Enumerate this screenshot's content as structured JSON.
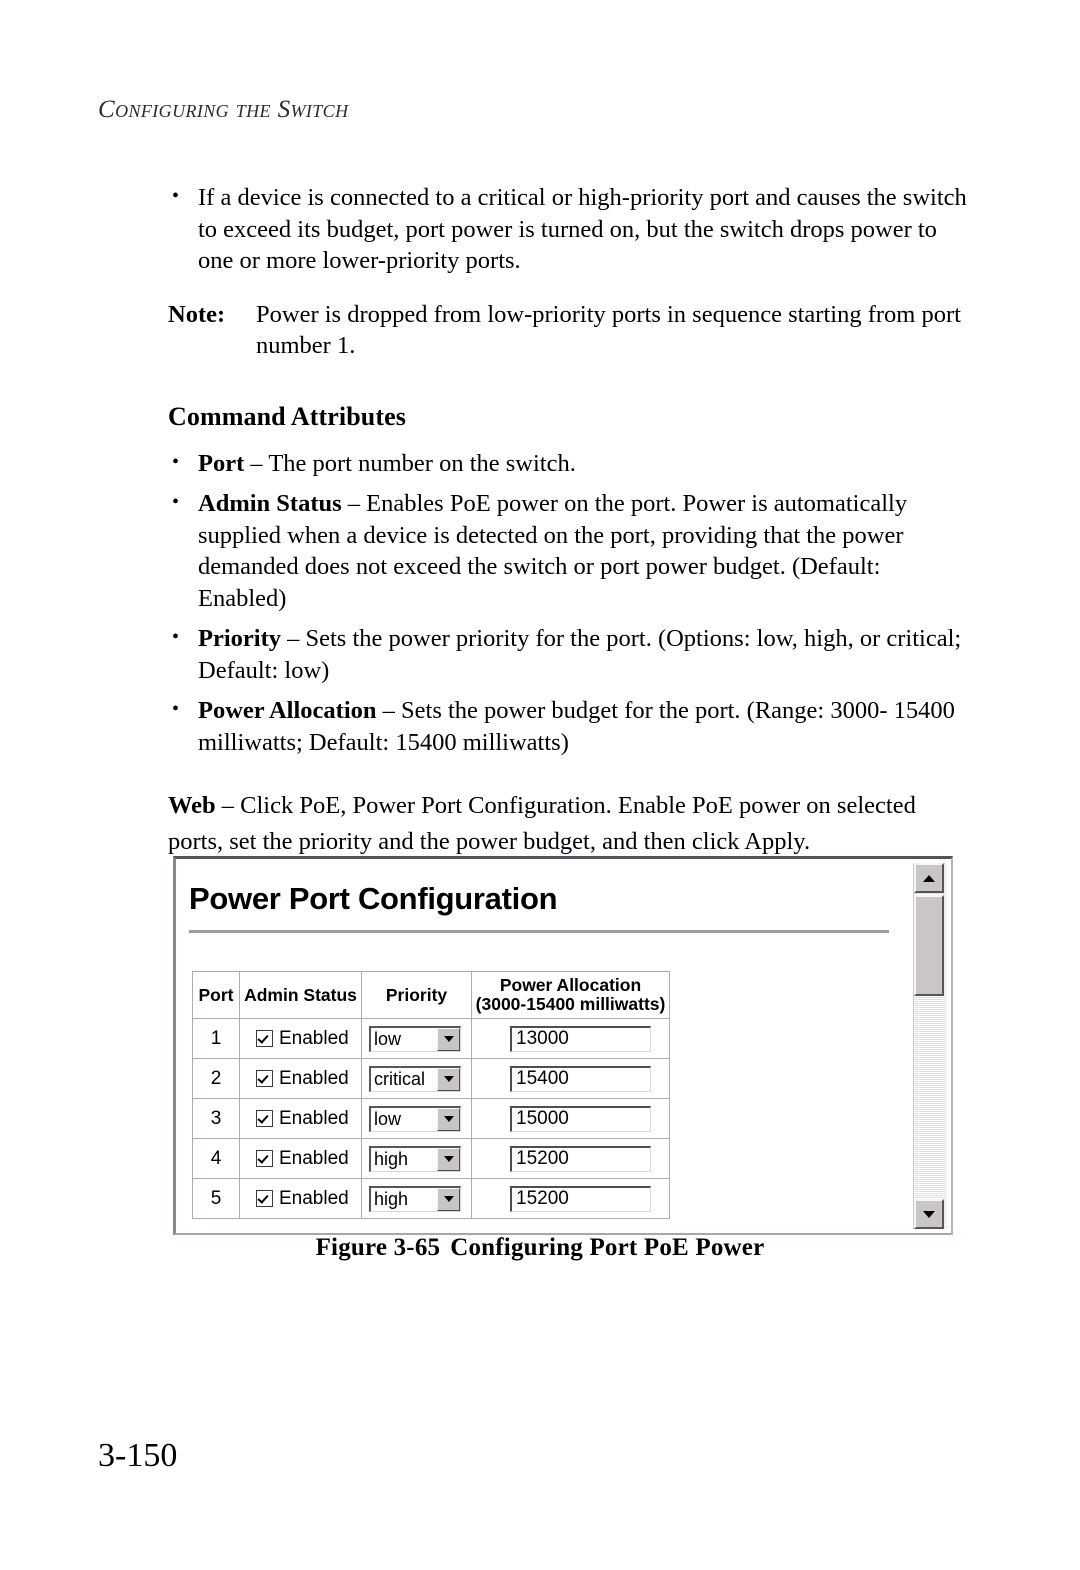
{
  "running_head": "Configuring the Switch",
  "intro": {
    "bullet_1": "If a device is connected to a critical or high-priority port and causes the switch to exceed its budget, port power is turned on, but the switch drops power to one or more lower-priority ports.",
    "note_label": "Note:",
    "note_text": "Power is dropped from low-priority ports in sequence starting from port number 1."
  },
  "command_attributes": {
    "heading": "Command Attributes",
    "items": [
      {
        "name": "Port",
        "dash": " – ",
        "desc": "The port number on the switch."
      },
      {
        "name": "Admin Status",
        "dash": " – ",
        "desc": "Enables PoE power on the port. Power is automatically supplied when a device is detected on the port, providing that the power demanded does not exceed the switch or port power budget. (Default: Enabled)"
      },
      {
        "name": "Priority",
        "dash": " – ",
        "desc": "Sets the power priority for the port. (Options: low, high, or critical; Default: low)"
      },
      {
        "name": "Power Allocation",
        "dash": " – ",
        "desc": "Sets the power budget for the port. (Range: 3000- 15400 milliwatts; Default: 15400 milliwatts)"
      }
    ]
  },
  "web_para": {
    "label": "Web",
    "dash": " – ",
    "text": "Click PoE, Power Port Configuration. Enable PoE power on selected ports, set the priority and the power budget, and then click Apply."
  },
  "screenshot": {
    "panel_title": "Power Port Configuration",
    "table": {
      "headers": {
        "port": "Port",
        "admin_status": "Admin Status",
        "priority": "Priority",
        "power_allocation_line1": "Power Allocation",
        "power_allocation_line2": "(3000-15400 milliwatts)"
      },
      "admin_status_label": "Enabled",
      "priority_options": [
        "low",
        "high",
        "critical"
      ],
      "rows": [
        {
          "port": "1",
          "admin_status": "Enabled",
          "admin_checked": true,
          "priority": "low",
          "power_allocation": "13000"
        },
        {
          "port": "2",
          "admin_status": "Enabled",
          "admin_checked": true,
          "priority": "critical",
          "power_allocation": "15400"
        },
        {
          "port": "3",
          "admin_status": "Enabled",
          "admin_checked": true,
          "priority": "low",
          "power_allocation": "15000"
        },
        {
          "port": "4",
          "admin_status": "Enabled",
          "admin_checked": true,
          "priority": "high",
          "power_allocation": "15200"
        },
        {
          "port": "5",
          "admin_status": "Enabled",
          "admin_checked": true,
          "priority": "high",
          "power_allocation": "15200"
        }
      ]
    },
    "scrollbar": {
      "up_arrow": "scroll-up",
      "down_arrow": "scroll-down",
      "thumb": "scroll-thumb"
    }
  },
  "figure": {
    "number": "Figure 3-65",
    "title": "Configuring Port PoE Power"
  },
  "page_number": "3-150",
  "colors": {
    "text": "#000000",
    "rule": "#9c9c9c",
    "chrome_face": "#c9c5c9",
    "table_border": "#b0a9b4"
  }
}
